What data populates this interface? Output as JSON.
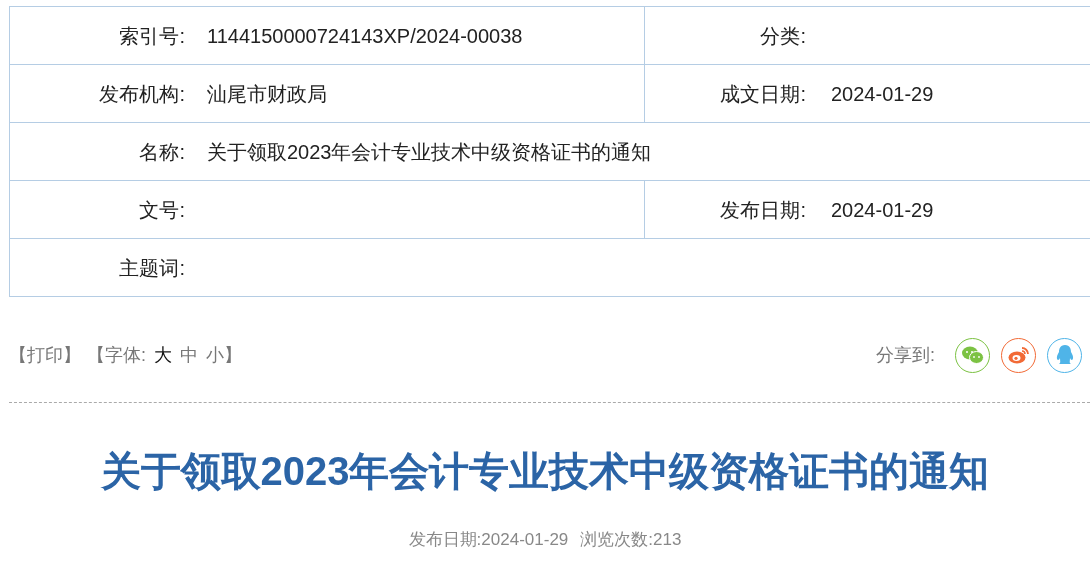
{
  "info_table": {
    "rows": [
      {
        "cells": [
          {
            "label": "索引号:",
            "value": "1144150000724143XP/2024-00038"
          },
          {
            "label": "分类:"
          }
        ]
      },
      {
        "cells": [
          {
            "label": "发布机构:",
            "value": "汕尾市财政局"
          },
          {
            "label": "成文日期:",
            "value": "2024-01-29"
          }
        ]
      },
      {
        "cells": [
          {
            "label": "名称:",
            "value": "关于领取2023年会计专业技术中级资格证书的通知"
          }
        ]
      },
      {
        "cells": [
          {
            "label": "文号:"
          },
          {
            "label": "发布日期:",
            "value": "2024-01-29"
          }
        ]
      },
      {
        "cells": [
          {
            "label": "主题词:"
          }
        ]
      }
    ]
  },
  "toolbar": {
    "print": "【打印】",
    "font_label": "【字体:",
    "font_sizes": [
      {
        "label": "大",
        "selected": true
      },
      {
        "label": "中",
        "selected": false
      },
      {
        "label": "小",
        "selected": false
      }
    ],
    "font_end": "】",
    "share_label": "分享到:",
    "share": [
      {
        "kind": "wechat"
      },
      {
        "kind": "weibo"
      },
      {
        "kind": "qq"
      }
    ]
  },
  "article": {
    "title": "关于领取2023年会计专业技术中级资格证书的通知",
    "publish_date": "发布日期:2024-01-29",
    "views": "浏览次数:213"
  }
}
